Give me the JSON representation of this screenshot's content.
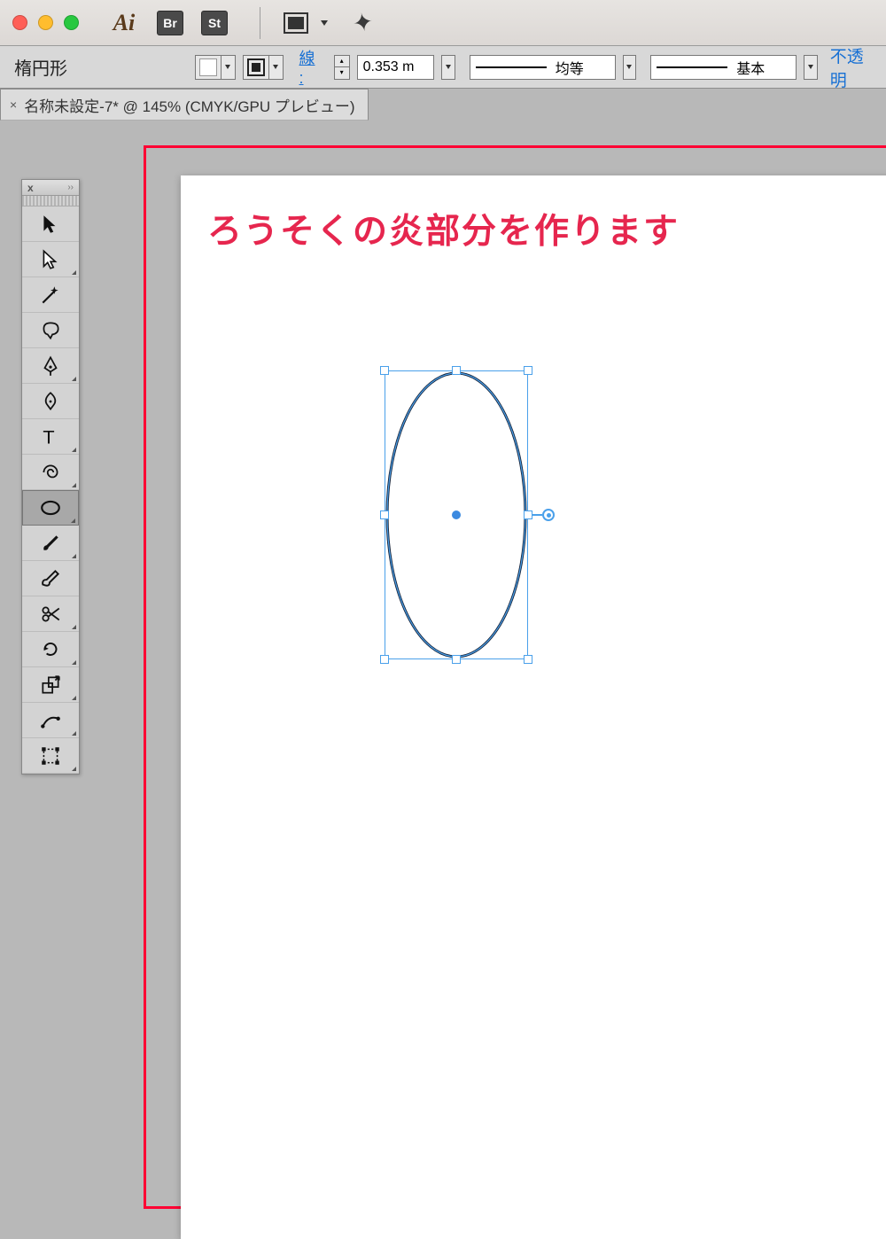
{
  "title_bar": {
    "badges": {
      "br": "Br",
      "st": "St"
    }
  },
  "control_bar": {
    "shape_name": "楕円形",
    "stroke_label": "線 :",
    "stroke_value": "0.353 m",
    "profile1": "均等",
    "profile2": "基本",
    "opacity_link": "不透明"
  },
  "tab": {
    "close": "×",
    "title": "名称未設定-7* @ 145% (CMYK/GPU プレビュー)"
  },
  "canvas": {
    "annotation": "ろうそくの炎部分を作ります"
  },
  "tools_panel": {
    "close": "x",
    "collapse": "››"
  }
}
